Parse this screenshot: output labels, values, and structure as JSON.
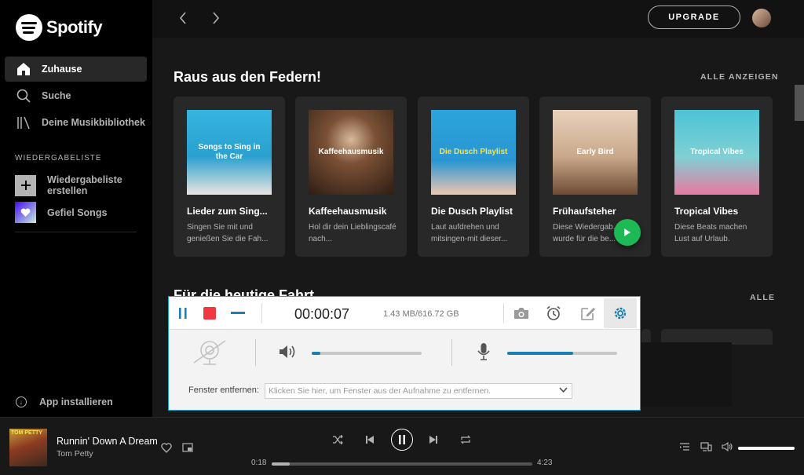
{
  "app": {
    "name": "Spotify"
  },
  "sidebar": {
    "nav": [
      {
        "label": "Zuhause",
        "icon": "home-icon"
      },
      {
        "label": "Suche",
        "icon": "search-icon"
      },
      {
        "label": "Deine Musikbibliothek",
        "icon": "library-icon"
      }
    ],
    "section_label": "WIEDERGABELISTE",
    "create_playlist": "Wiedergabeliste erstellen",
    "liked_songs": "Gefiel Songs",
    "install_app": "App installieren"
  },
  "header": {
    "upgrade_label": "UPGRADE"
  },
  "section1": {
    "title": "Raus aus den Federn!",
    "see_all": "ALLE ANZEIGEN",
    "cards": [
      {
        "title": "Lieder zum Sing...",
        "desc": "Singen Sie mit und genießen Sie die Fah...",
        "art_text": "Songs to Sing in the Car",
        "color": "#2ba8d6"
      },
      {
        "title": "Kaffeehausmusik",
        "desc": "Hol dir dein Lieblingscafé nach...",
        "art_text": "Kaffeehausmusik",
        "color": "#5a3b26"
      },
      {
        "title": "Die Dusch Playlist",
        "desc": "Laut aufdrehen und mitsingen-mit dieser...",
        "art_text": "Die Dusch Playlist",
        "color": "#2c9fd9"
      },
      {
        "title": "Frühaufsteher",
        "desc": "Diese Wiedergab... wurde für die be...",
        "art_text": "Early Bird",
        "color": "#c9a88a"
      },
      {
        "title": "Tropical Vibes",
        "desc": "Diese Beats machen Lust auf Urlaub.",
        "art_text": "Tropical Vibes",
        "color": "#3fb6c9"
      }
    ]
  },
  "section2": {
    "title": "Für die heutige Fahrt",
    "see_all": "ALLE"
  },
  "player": {
    "track": "Runnin' Down A Dream",
    "artist": "Tom Petty",
    "cover_text": "TOM PETTY",
    "elapsed": "0:18",
    "duration": "4:23",
    "progress": 0.07,
    "volume": 1.0
  },
  "recorder": {
    "time": "00:00:07",
    "size": "1.43 MB/616.72 GB",
    "speaker_level": 0.08,
    "mic_level": 0.6,
    "remove_label": "Fenster entfernen:",
    "remove_placeholder": "Klicken Sie hier, um Fenster aus der Aufnahme zu entfernen.",
    "colors": {
      "record": "#f0383e",
      "accent": "#1a7fb5",
      "border": "#1fa2c7"
    }
  }
}
